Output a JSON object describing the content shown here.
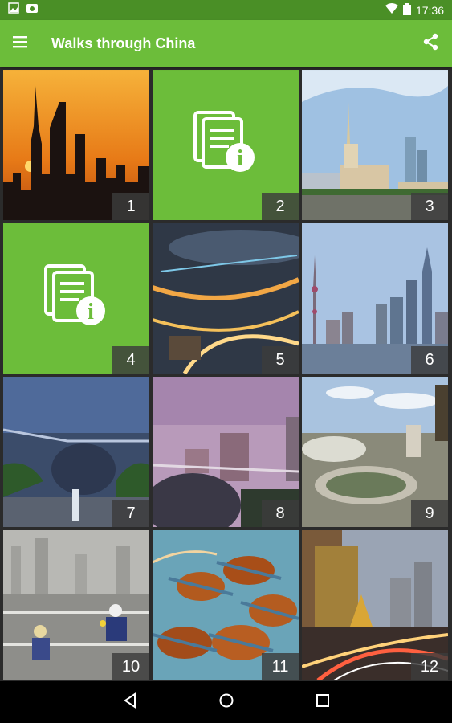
{
  "status_bar": {
    "time": "17:36",
    "left_icons": [
      "image-icon",
      "photo-icon"
    ],
    "right_icons": [
      "wifi-icon",
      "battery-icon"
    ]
  },
  "app_bar": {
    "title": "Walks through China",
    "menu_icon": "hamburger-menu-icon",
    "share_icon": "share-icon"
  },
  "tiles": [
    {
      "label": "1",
      "kind": "photo",
      "subject": "sunset skyline"
    },
    {
      "label": "2",
      "kind": "info"
    },
    {
      "label": "3",
      "kind": "photo",
      "subject": "exhibition hall tower"
    },
    {
      "label": "4",
      "kind": "info"
    },
    {
      "label": "5",
      "kind": "photo",
      "subject": "night interchange"
    },
    {
      "label": "6",
      "kind": "photo",
      "subject": "waterfront skyline"
    },
    {
      "label": "7",
      "kind": "photo",
      "subject": "modern building dusk"
    },
    {
      "label": "8",
      "kind": "photo",
      "subject": "dome and towers"
    },
    {
      "label": "9",
      "kind": "photo",
      "subject": "stadium aerial"
    },
    {
      "label": "10",
      "kind": "photo",
      "subject": "construction workers"
    },
    {
      "label": "11",
      "kind": "photo",
      "subject": "tied crabs"
    },
    {
      "label": "12",
      "kind": "photo",
      "subject": "street at night"
    }
  ],
  "nav_bar": {
    "icons": [
      "back-icon",
      "home-icon",
      "recents-icon"
    ]
  },
  "colors": {
    "accent": "#6cbd3a",
    "status_bar": "#4a8f26"
  }
}
